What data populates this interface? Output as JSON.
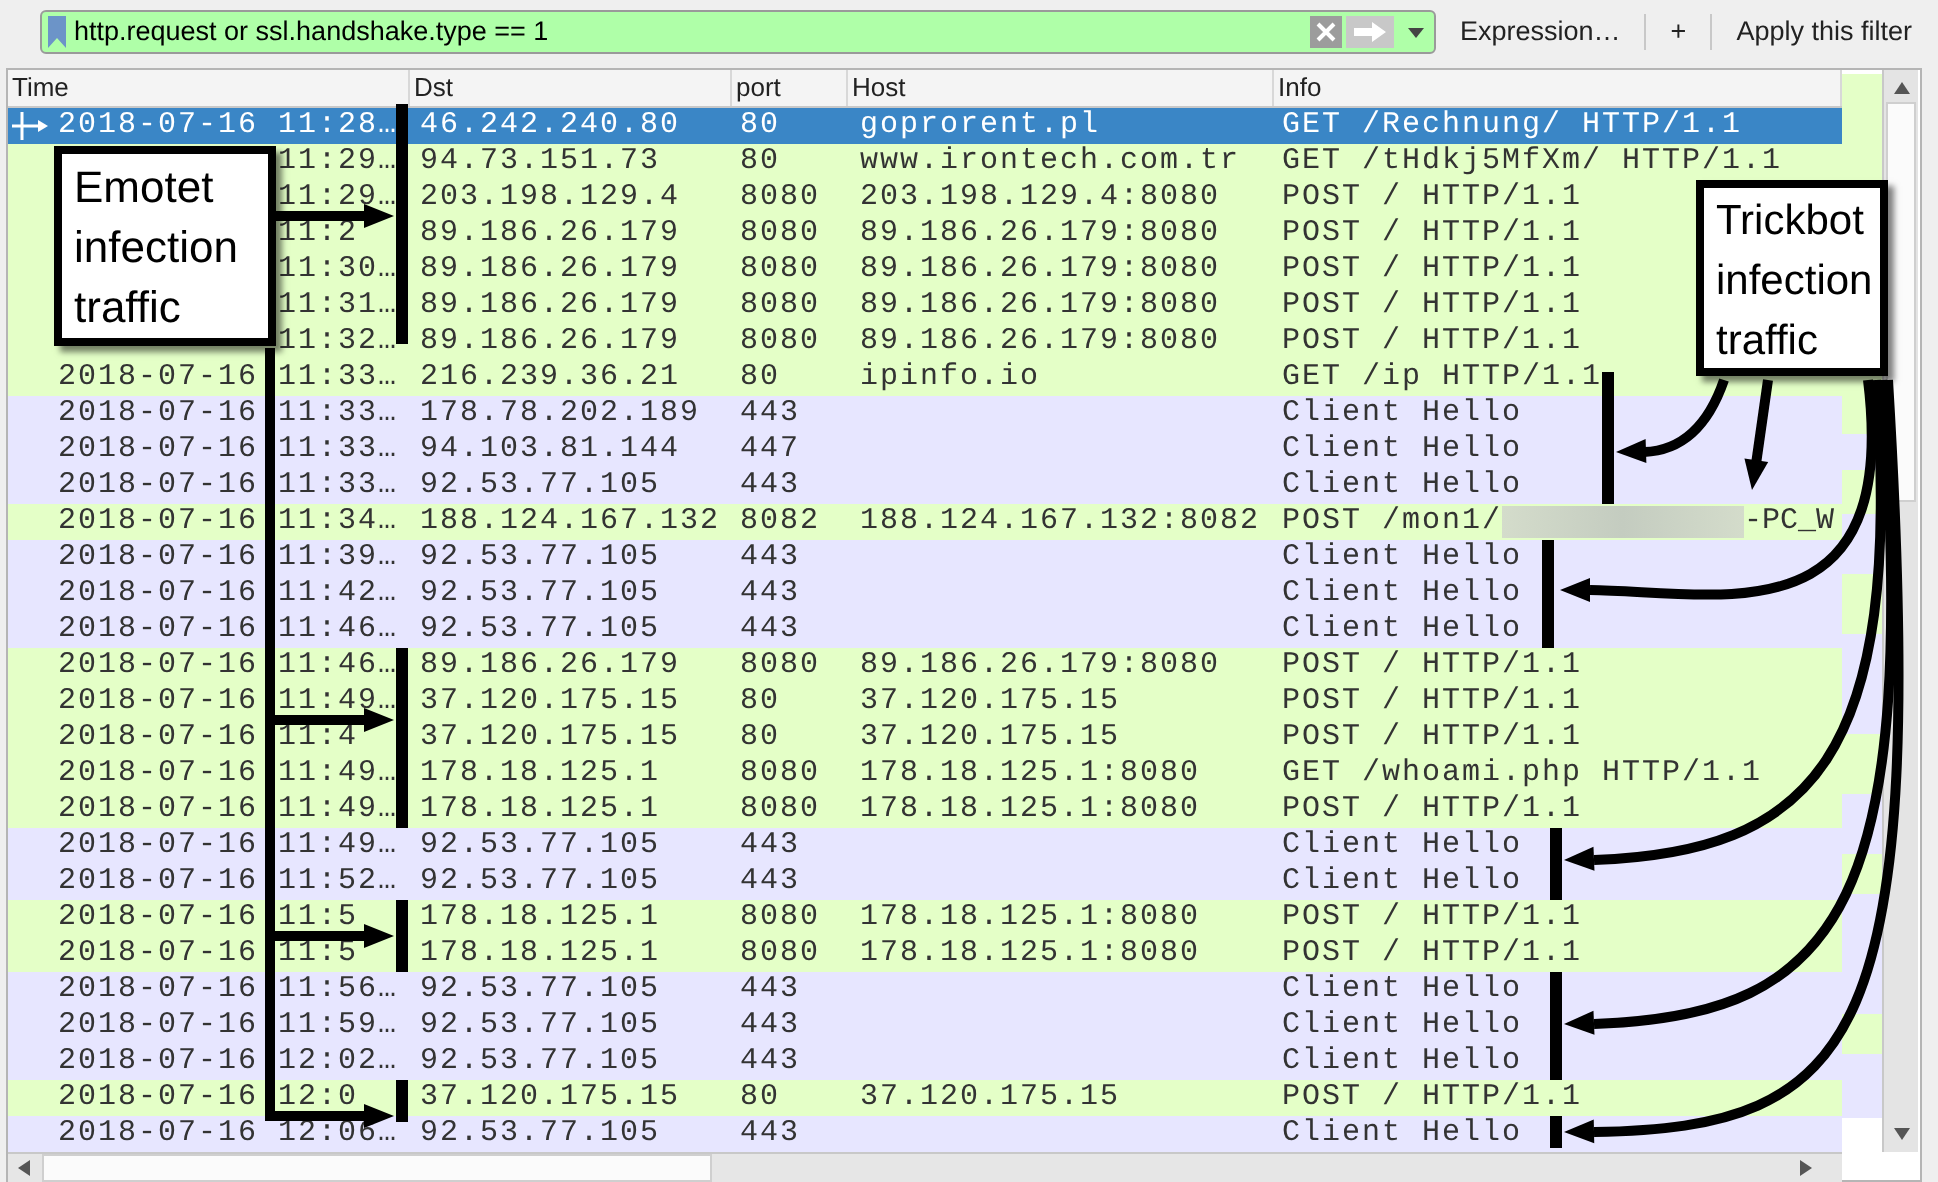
{
  "filter": {
    "value": "http.request or ssl.handshake.type == 1"
  },
  "toolbar_buttons": [
    "Expression…",
    "+",
    "Apply this filter"
  ],
  "columns": [
    "Time",
    "Dst",
    "port",
    "Host",
    "Info"
  ],
  "rows": [
    {
      "selected": true,
      "date": "2018-07-16",
      "clock": "11:28…",
      "dst": "46.242.240.80",
      "port": "80",
      "host": "goprorent.pl",
      "info": "GET /Rechnung/ HTTP/1.1"
    },
    {
      "kind": "http",
      "selected": false,
      "clock": "11:29…",
      "dst": "94.73.151.73",
      "port": "80",
      "host": "www.irontech.com.tr",
      "info": "GET /tHdkj5MfXm/ HTTP/1.1"
    },
    {
      "kind": "http",
      "selected": false,
      "clock": "11:29…",
      "dst": "203.198.129.4",
      "port": "8080",
      "host": "203.198.129.4:8080",
      "info": "POST / HTTP/1.1"
    },
    {
      "kind": "http",
      "selected": false,
      "clock": "11:2",
      "dst": "89.186.26.179",
      "port": "8080",
      "host": "89.186.26.179:8080",
      "info": "POST / HTTP/1.1"
    },
    {
      "kind": "http",
      "selected": false,
      "clock": "11:30…",
      "dst": "89.186.26.179",
      "port": "8080",
      "host": "89.186.26.179:8080",
      "info": "POST / HTTP/1.1"
    },
    {
      "kind": "http",
      "selected": false,
      "clock": "11:31…",
      "dst": "89.186.26.179",
      "port": "8080",
      "host": "89.186.26.179:8080",
      "info": "POST / HTTP/1.1"
    },
    {
      "kind": "http",
      "selected": false,
      "clock": "11:32…",
      "dst": "89.186.26.179",
      "port": "8080",
      "host": "89.186.26.179:8080",
      "info": "POST / HTTP/1.1"
    },
    {
      "kind": "http",
      "selected": false,
      "date": "2018-07-16",
      "clock": "11:33…",
      "dst": "216.239.36.21",
      "port": "80",
      "host": "ipinfo.io",
      "info": "GET /ip HTTP/1.1"
    },
    {
      "kind": "tls",
      "selected": false,
      "date": "2018-07-16",
      "clock": "11:33…",
      "dst": "178.78.202.189",
      "port": "443",
      "info": "Client Hello"
    },
    {
      "kind": "tls",
      "selected": false,
      "date": "2018-07-16",
      "clock": "11:33…",
      "dst": "94.103.81.144",
      "port": "447",
      "info": "Client Hello"
    },
    {
      "kind": "tls",
      "selected": false,
      "date": "2018-07-16",
      "clock": "11:33…",
      "dst": "92.53.77.105",
      "port": "443",
      "info": "Client Hello"
    },
    {
      "kind": "http",
      "selected": false,
      "date": "2018-07-16",
      "clock": "11:34…",
      "dst": "188.124.167.132",
      "port": "8082",
      "host": "188.124.167.132:8082",
      "info": "POST /mon1/",
      "redacted": true,
      "info_tail": "-PC_W"
    },
    {
      "kind": "tls",
      "selected": false,
      "date": "2018-07-16",
      "clock": "11:39…",
      "dst": "92.53.77.105",
      "port": "443",
      "info": "Client Hello"
    },
    {
      "kind": "tls",
      "selected": false,
      "date": "2018-07-16",
      "clock": "11:42…",
      "dst": "92.53.77.105",
      "port": "443",
      "info": "Client Hello"
    },
    {
      "kind": "tls",
      "selected": false,
      "date": "2018-07-16",
      "clock": "11:46…",
      "dst": "92.53.77.105",
      "port": "443",
      "info": "Client Hello"
    },
    {
      "kind": "http",
      "selected": false,
      "date": "2018-07-16",
      "clock": "11:46…",
      "dst": "89.186.26.179",
      "port": "8080",
      "host": "89.186.26.179:8080",
      "info": "POST / HTTP/1.1"
    },
    {
      "kind": "http",
      "selected": false,
      "date": "2018-07-16",
      "clock": "11:49…",
      "dst": "37.120.175.15",
      "port": "80",
      "host": "37.120.175.15",
      "info": "POST / HTTP/1.1"
    },
    {
      "kind": "http",
      "selected": false,
      "date": "2018-07-16",
      "clock": "11:4",
      "dst": "37.120.175.15",
      "port": "80",
      "host": "37.120.175.15",
      "info": "POST / HTTP/1.1"
    },
    {
      "kind": "http",
      "selected": false,
      "date": "2018-07-16",
      "clock": "11:49…",
      "dst": "178.18.125.1",
      "port": "8080",
      "host": "178.18.125.1:8080",
      "info": "GET /whoami.php HTTP/1.1"
    },
    {
      "kind": "http",
      "selected": false,
      "date": "2018-07-16",
      "clock": "11:49…",
      "dst": "178.18.125.1",
      "port": "8080",
      "host": "178.18.125.1:8080",
      "info": "POST / HTTP/1.1"
    },
    {
      "kind": "tls",
      "selected": false,
      "date": "2018-07-16",
      "clock": "11:49…",
      "dst": "92.53.77.105",
      "port": "443",
      "info": "Client Hello"
    },
    {
      "kind": "tls",
      "selected": false,
      "date": "2018-07-16",
      "clock": "11:52…",
      "dst": "92.53.77.105",
      "port": "443",
      "info": "Client Hello"
    },
    {
      "kind": "http",
      "selected": false,
      "date": "2018-07-16",
      "clock": "11:5",
      "dst": "178.18.125.1",
      "port": "8080",
      "host": "178.18.125.1:8080",
      "info": "POST / HTTP/1.1"
    },
    {
      "kind": "http",
      "selected": false,
      "date": "2018-07-16",
      "clock": "11:5",
      "dst": "178.18.125.1",
      "port": "8080",
      "host": "178.18.125.1:8080",
      "info": "POST / HTTP/1.1"
    },
    {
      "kind": "tls",
      "selected": false,
      "date": "2018-07-16",
      "clock": "11:56…",
      "dst": "92.53.77.105",
      "port": "443",
      "info": "Client Hello"
    },
    {
      "kind": "tls",
      "selected": false,
      "date": "2018-07-16",
      "clock": "11:59…",
      "dst": "92.53.77.105",
      "port": "443",
      "info": "Client Hello"
    },
    {
      "kind": "tls",
      "selected": false,
      "date": "2018-07-16",
      "clock": "12:02…",
      "dst": "92.53.77.105",
      "port": "443",
      "info": "Client Hello"
    },
    {
      "kind": "http",
      "selected": false,
      "date": "2018-07-16",
      "clock": "12:0",
      "dst": "37.120.175.15",
      "port": "80",
      "host": "37.120.175.15",
      "info": "POST / HTTP/1.1"
    },
    {
      "kind": "tls",
      "selected": false,
      "date": "2018-07-16",
      "clock": "12:06…",
      "dst": "92.53.77.105",
      "port": "443",
      "info": "Client Hello"
    }
  ],
  "annotations": [
    {
      "text": "Emotet infection traffic"
    },
    {
      "text": "Trickbot infection traffic"
    }
  ]
}
